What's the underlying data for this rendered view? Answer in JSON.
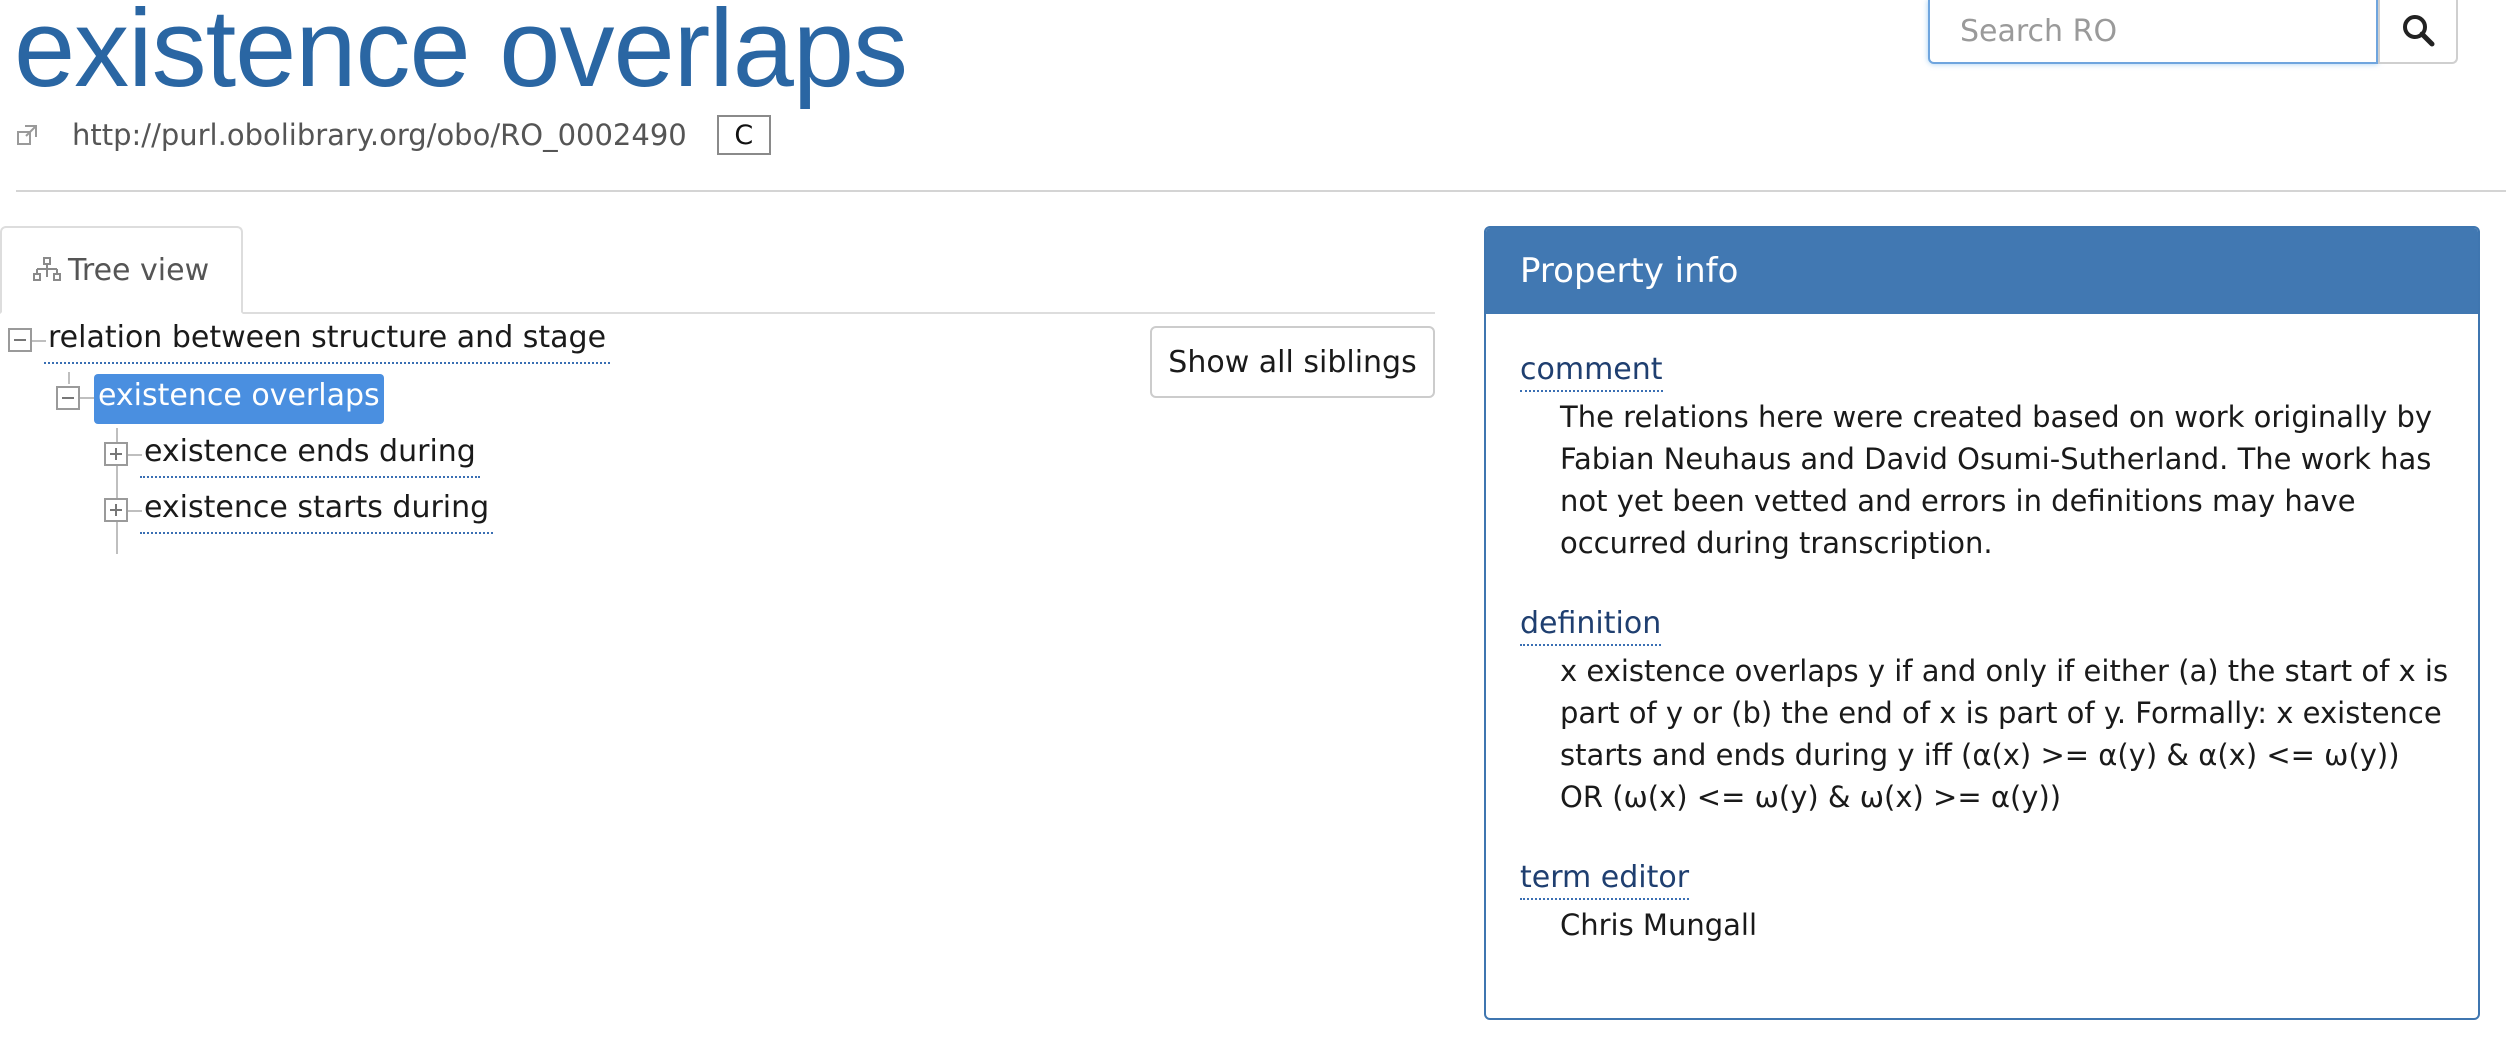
{
  "header": {
    "title": "existence overlaps",
    "iri": "http://purl.obolibrary.org/obo/RO_0002490",
    "copy_label": "C"
  },
  "search": {
    "placeholder": "Search RO",
    "value": ""
  },
  "tabs": [
    {
      "label": "Tree view",
      "icon": "sitemap-icon",
      "active": true
    }
  ],
  "tree": {
    "nodes": [
      {
        "label": "relation between structure and stage",
        "level": 0,
        "expanded": true
      },
      {
        "label": "existence overlaps",
        "level": 1,
        "expanded": true,
        "selected": true
      },
      {
        "label": "existence ends during",
        "level": 2,
        "expanded": false
      },
      {
        "label": "existence starts during",
        "level": 2,
        "expanded": false
      }
    ],
    "show_siblings_label": "Show all siblings"
  },
  "panel": {
    "title": "Property info",
    "properties": [
      {
        "key": "comment",
        "value": "The relations here were created based on work originally by Fabian Neuhaus and David Osumi-Sutherland. The work has not yet been vetted and errors in definitions may have occurred during transcription."
      },
      {
        "key": "definition",
        "value": "x existence overlaps y if and only if either (a) the start of x is part of y or (b) the end of x is part of y. Formally: x existence starts and ends during y iff (α(x) >= α(y) & α(x) <= ω(y)) OR (ω(x) <= ω(y) & ω(x) >= α(y))"
      },
      {
        "key": "term editor",
        "value": "Chris Mungall"
      }
    ]
  },
  "colors": {
    "title": "#2a66a3",
    "panel_header": "#4178b2",
    "selected_node": "#4a8fe0"
  }
}
